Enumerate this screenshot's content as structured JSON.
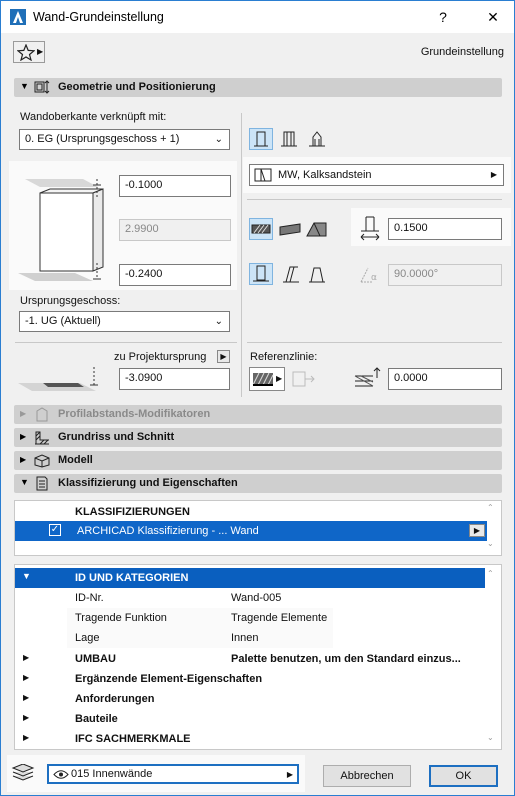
{
  "window": {
    "title": "Wand-Grundeinstellung",
    "help": "?",
    "close": "✕"
  },
  "favorites": {
    "label": "Grundeinstellung"
  },
  "sections": {
    "geometry": "Geometrie und Positionierung",
    "profile": "Profilabstands-Modifikatoren",
    "plan": "Grundriss und Schnitt",
    "model": "Modell",
    "classification": "Klassifizierung und Eigenschaften"
  },
  "geometry": {
    "top_link_label": "Wandoberkante verknüpft mit:",
    "top_link_value": "0. EG (Ursprungsgeschoss + 1)",
    "top_offset": "-0.1000",
    "height": "2.9900",
    "bottom_offset": "-0.2400",
    "home_story_label": "Ursprungsgeschoss:",
    "home_story_value": "-1. UG (Aktuell)",
    "to_project_zero_label": "zu Projektursprung",
    "to_project_zero_value": "-3.0900",
    "material": "MW, Kalksandstein",
    "thickness": "0.1500",
    "angle": "90.0000°",
    "reference_line_label": "Referenzlinie:",
    "reference_offset": "0.0000"
  },
  "classifications": {
    "header": "KLASSIFIZIERUNGEN",
    "item": "ARCHICAD Klassifizierung - ... Wand"
  },
  "properties": {
    "group_header": "ID UND KATEGORIEN",
    "rows": [
      {
        "name": "ID-Nr.",
        "value": "Wand-005"
      },
      {
        "name": "Tragende Funktion",
        "value": "Tragende Elemente"
      },
      {
        "name": "Lage",
        "value": "Innen"
      }
    ],
    "groups": [
      {
        "name": "UMBAU",
        "value": "Palette benutzen, um den Standard einzus..."
      },
      {
        "name": "Ergänzende Element-Eigenschaften",
        "value": ""
      },
      {
        "name": "Anforderungen",
        "value": ""
      },
      {
        "name": "Bauteile",
        "value": ""
      },
      {
        "name": "IFC SACHMERKMALE",
        "value": ""
      }
    ]
  },
  "footer": {
    "layer": "015 Innenwände",
    "cancel": "Abbrechen",
    "ok": "OK"
  },
  "colors": {
    "accent": "#0a5fbf",
    "selection": "#0f66c8"
  }
}
